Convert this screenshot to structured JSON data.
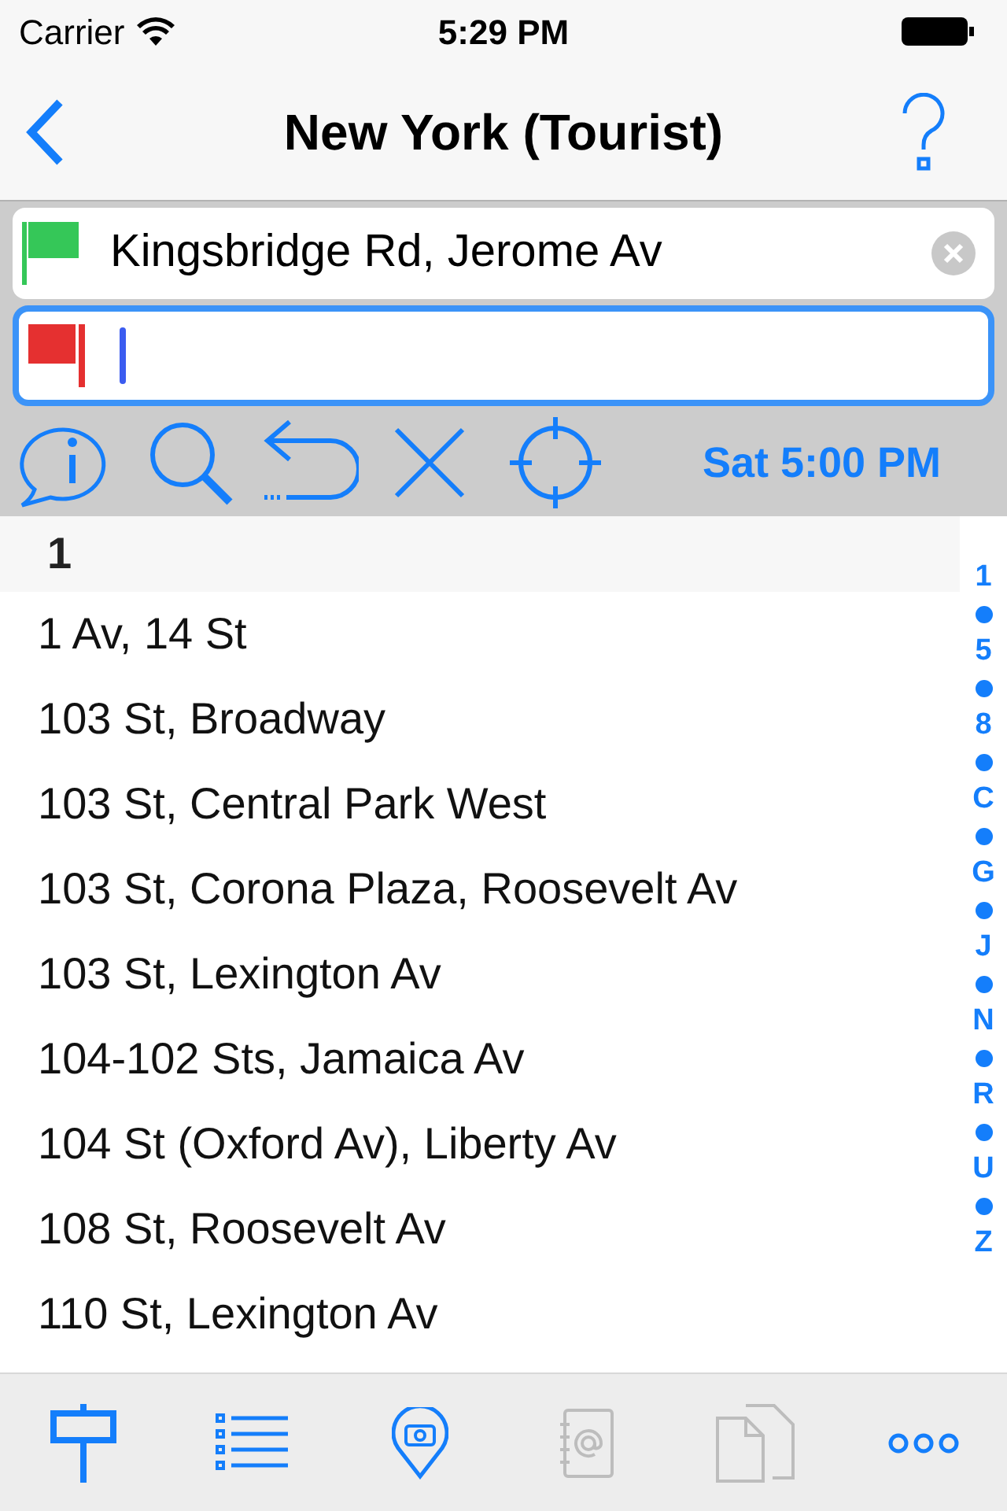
{
  "status_bar": {
    "carrier": "Carrier",
    "time": "5:29 PM"
  },
  "nav": {
    "title": "New York (Tourist)"
  },
  "from_field": {
    "value": "Kingsbridge Rd, Jerome Av"
  },
  "to_field": {
    "focused": true
  },
  "toolbar": {
    "time": "Sat 5:00 PM"
  },
  "section": {
    "title": "1"
  },
  "rows": [
    "1 Av, 14 St",
    "103 St, Broadway",
    "103 St, Central Park West",
    "103 St, Corona Plaza, Roosevelt Av",
    "103 St, Lexington Av",
    "104-102 Sts, Jamaica Av",
    "104 St (Oxford Av), Liberty Av",
    "108 St, Roosevelt Av",
    "110 St, Lexington Av"
  ],
  "index": [
    "1",
    "5",
    "8",
    "C",
    "G",
    "J",
    "N",
    "R",
    "U",
    "Z"
  ],
  "tab_bar": [
    {
      "kind": "sign",
      "disabled": false
    },
    {
      "kind": "list",
      "disabled": false
    },
    {
      "kind": "camera-pin",
      "disabled": false
    },
    {
      "kind": "address-book",
      "disabled": true
    },
    {
      "kind": "documents",
      "disabled": true
    },
    {
      "kind": "more",
      "disabled": false
    }
  ]
}
